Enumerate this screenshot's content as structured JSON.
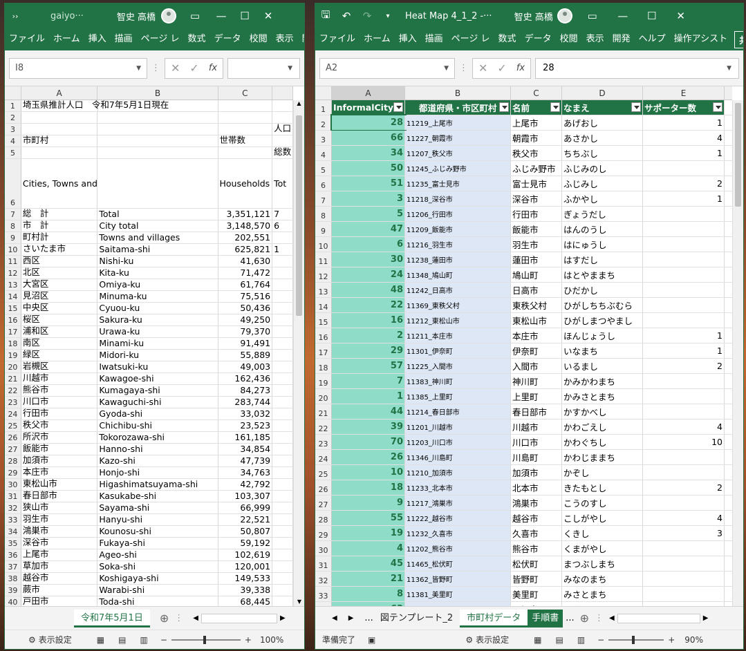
{
  "left": {
    "title": "gaiyo···",
    "user": "智史 高橋",
    "ribbon": [
      "ファイル",
      "ホーム",
      "挿入",
      "描画",
      "ページ レ",
      "数式",
      "データ",
      "校閲",
      "表示",
      "開発"
    ],
    "namebox": "I8",
    "cols": [
      "A",
      "B",
      "C"
    ],
    "rows": [
      {
        "n": "1",
        "a": "埼玉県推計人口　令和7年5月1日現在",
        "b": "",
        "c": "",
        "d": ""
      },
      {
        "n": "2",
        "a": "",
        "b": "",
        "c": "",
        "d": ""
      },
      {
        "n": "3",
        "a": "",
        "b": "",
        "c": "",
        "d": "人口"
      },
      {
        "n": "4",
        "a": "市町村",
        "b": "",
        "c": "世帯数",
        "d": ""
      },
      {
        "n": "5",
        "a": "",
        "b": "",
        "c": "",
        "d": "総数"
      },
      {
        "n": "6",
        "a": "Cities, Towns and Villages",
        "b": "",
        "c": "Households",
        "d": "Tot"
      },
      {
        "n": "7",
        "a": "総　計",
        "b": "Total",
        "c": "3,351,121",
        "d": "7"
      },
      {
        "n": "8",
        "a": "市　計",
        "b": "City total",
        "c": "3,148,570",
        "d": "6"
      },
      {
        "n": "9",
        "a": "町村計",
        "b": "Towns and villages",
        "c": "202,551",
        "d": ""
      },
      {
        "n": "10",
        "a": "さいたま市",
        "b": "Saitama-shi",
        "c": "625,821",
        "d": "1"
      },
      {
        "n": "11",
        "a": "西区",
        "b": "Nishi-ku",
        "c": "41,630",
        "d": ""
      },
      {
        "n": "12",
        "a": "北区",
        "b": "Kita-ku",
        "c": "71,472",
        "d": ""
      },
      {
        "n": "13",
        "a": "大宮区",
        "b": "Omiya-ku",
        "c": "61,764",
        "d": ""
      },
      {
        "n": "14",
        "a": "見沼区",
        "b": "Minuma-ku",
        "c": "75,516",
        "d": ""
      },
      {
        "n": "15",
        "a": "中央区",
        "b": "Cyuou-ku",
        "c": "50,436",
        "d": ""
      },
      {
        "n": "16",
        "a": "桜区",
        "b": "Sakura-ku",
        "c": "49,250",
        "d": ""
      },
      {
        "n": "17",
        "a": "浦和区",
        "b": "Urawa-ku",
        "c": "79,370",
        "d": ""
      },
      {
        "n": "18",
        "a": "南区",
        "b": "Minami-ku",
        "c": "91,491",
        "d": ""
      },
      {
        "n": "19",
        "a": "緑区",
        "b": "Midori-ku",
        "c": "55,889",
        "d": ""
      },
      {
        "n": "20",
        "a": "岩槻区",
        "b": "Iwatsuki-ku",
        "c": "49,003",
        "d": ""
      },
      {
        "n": "21",
        "a": "川越市",
        "b": "Kawagoe-shi",
        "c": "162,436",
        "d": ""
      },
      {
        "n": "22",
        "a": "熊谷市",
        "b": "Kumagaya-shi",
        "c": "84,273",
        "d": ""
      },
      {
        "n": "23",
        "a": "川口市",
        "b": "Kawaguchi-shi",
        "c": "283,744",
        "d": ""
      },
      {
        "n": "24",
        "a": "行田市",
        "b": "Gyoda-shi",
        "c": "33,032",
        "d": ""
      },
      {
        "n": "25",
        "a": "秩父市",
        "b": "Chichibu-shi",
        "c": "23,523",
        "d": ""
      },
      {
        "n": "26",
        "a": "所沢市",
        "b": "Tokorozawa-shi",
        "c": "161,185",
        "d": ""
      },
      {
        "n": "27",
        "a": "飯能市",
        "b": "Hanno-shi",
        "c": "34,854",
        "d": ""
      },
      {
        "n": "28",
        "a": "加須市",
        "b": "Kazo-shi",
        "c": "47,739",
        "d": ""
      },
      {
        "n": "29",
        "a": "本庄市",
        "b": "Honjo-shi",
        "c": "34,763",
        "d": ""
      },
      {
        "n": "30",
        "a": "東松山市",
        "b": "Higashimatsuyama-shi",
        "c": "42,792",
        "d": ""
      },
      {
        "n": "31",
        "a": "春日部市",
        "b": "Kasukabe-shi",
        "c": "103,307",
        "d": ""
      },
      {
        "n": "32",
        "a": "狭山市",
        "b": "Sayama-shi",
        "c": "66,999",
        "d": ""
      },
      {
        "n": "33",
        "a": "羽生市",
        "b": "Hanyu-shi",
        "c": "22,521",
        "d": ""
      },
      {
        "n": "34",
        "a": "鴻巣市",
        "b": "Kounosu-shi",
        "c": "50,807",
        "d": ""
      },
      {
        "n": "35",
        "a": "深谷市",
        "b": "Fukaya-shi",
        "c": "59,192",
        "d": ""
      },
      {
        "n": "36",
        "a": "上尾市",
        "b": "Ageo-shi",
        "c": "102,619",
        "d": ""
      },
      {
        "n": "37",
        "a": "草加市",
        "b": "Soka-shi",
        "c": "120,001",
        "d": ""
      },
      {
        "n": "38",
        "a": "越谷市",
        "b": "Koshigaya-shi",
        "c": "149,533",
        "d": ""
      },
      {
        "n": "39",
        "a": "蕨市",
        "b": "Warabi-shi",
        "c": "39,338",
        "d": ""
      },
      {
        "n": "40",
        "a": "戸田市",
        "b": "Toda-shi",
        "c": "68,445",
        "d": ""
      }
    ],
    "sheet_tab": "令和7年5月1日",
    "status_display": "表示設定",
    "zoom": "100%"
  },
  "right": {
    "title": "Heat Map 4_1_2 -···",
    "user": "智史 高橋",
    "ribbon": [
      "ファイル",
      "ホーム",
      "挿入",
      "描画",
      "ページ レ",
      "数式",
      "データ",
      "校閲",
      "表示",
      "開発",
      "ヘルプ",
      "操作アシスト"
    ],
    "share": "共有",
    "namebox": "A2",
    "formula": "28",
    "cols": [
      "A",
      "B",
      "C",
      "D",
      "E"
    ],
    "headers": [
      "InformalCity",
      "都道府県・市区町村",
      "名前",
      "なまえ",
      "サポーター数"
    ],
    "rows": [
      {
        "n": "2",
        "a": "28",
        "b": "11219_上尾市",
        "c": "上尾市",
        "d": "あげおし",
        "e": "1"
      },
      {
        "n": "3",
        "a": "66",
        "b": "11227_朝霞市",
        "c": "朝霞市",
        "d": "あさかし",
        "e": "4"
      },
      {
        "n": "4",
        "a": "34",
        "b": "11207_秩父市",
        "c": "秩父市",
        "d": "ちちぶし",
        "e": "1"
      },
      {
        "n": "5",
        "a": "50",
        "b": "11245_ふじみ野市",
        "c": "ふじみ野市",
        "d": "ふじみのし",
        "e": ""
      },
      {
        "n": "6",
        "a": "51",
        "b": "11235_富士見市",
        "c": "富士見市",
        "d": "ふじみし",
        "e": "2"
      },
      {
        "n": "7",
        "a": "3",
        "b": "11218_深谷市",
        "c": "深谷市",
        "d": "ふかやし",
        "e": "1"
      },
      {
        "n": "8",
        "a": "5",
        "b": "11206_行田市",
        "c": "行田市",
        "d": "ぎょうだし",
        "e": ""
      },
      {
        "n": "9",
        "a": "47",
        "b": "11209_飯能市",
        "c": "飯能市",
        "d": "はんのうし",
        "e": ""
      },
      {
        "n": "10",
        "a": "6",
        "b": "11216_羽生市",
        "c": "羽生市",
        "d": "はにゅうし",
        "e": ""
      },
      {
        "n": "11",
        "a": "30",
        "b": "11238_蓮田市",
        "c": "蓮田市",
        "d": "はすだし",
        "e": ""
      },
      {
        "n": "12",
        "a": "24",
        "b": "11348_鳩山町",
        "c": "鳩山町",
        "d": "はとやままち",
        "e": ""
      },
      {
        "n": "13",
        "a": "48",
        "b": "11242_日高市",
        "c": "日高市",
        "d": "ひだかし",
        "e": ""
      },
      {
        "n": "14",
        "a": "22",
        "b": "11369_東秩父村",
        "c": "東秩父村",
        "d": "ひがしちちぶむら",
        "e": ""
      },
      {
        "n": "15",
        "a": "16",
        "b": "11212_東松山市",
        "c": "東松山市",
        "d": "ひがしまつやまし",
        "e": ""
      },
      {
        "n": "16",
        "a": "2",
        "b": "11211_本庄市",
        "c": "本庄市",
        "d": "ほんじょうし",
        "e": "1"
      },
      {
        "n": "17",
        "a": "29",
        "b": "11301_伊奈町",
        "c": "伊奈町",
        "d": "いなまち",
        "e": "1"
      },
      {
        "n": "18",
        "a": "57",
        "b": "11225_入間市",
        "c": "入間市",
        "d": "いるまし",
        "e": "2"
      },
      {
        "n": "19",
        "a": "7",
        "b": "11383_神川町",
        "c": "神川町",
        "d": "かみかわまち",
        "e": ""
      },
      {
        "n": "20",
        "a": "1",
        "b": "11385_上里町",
        "c": "上里町",
        "d": "かみさとまち",
        "e": ""
      },
      {
        "n": "21",
        "a": "44",
        "b": "11214_春日部市",
        "c": "春日部市",
        "d": "かすかべし",
        "e": ""
      },
      {
        "n": "22",
        "a": "39",
        "b": "11201_川越市",
        "c": "川越市",
        "d": "かわごえし",
        "e": "4"
      },
      {
        "n": "23",
        "a": "70",
        "b": "11203_川口市",
        "c": "川口市",
        "d": "かわぐちし",
        "e": "10"
      },
      {
        "n": "24",
        "a": "26",
        "b": "11346_川島町",
        "c": "川島町",
        "d": "かわじままち",
        "e": ""
      },
      {
        "n": "25",
        "a": "10",
        "b": "11210_加須市",
        "c": "加須市",
        "d": "かぞし",
        "e": ""
      },
      {
        "n": "26",
        "a": "18",
        "b": "11233_北本市",
        "c": "北本市",
        "d": "きたもとし",
        "e": "2"
      },
      {
        "n": "27",
        "a": "9",
        "b": "11217_鴻巣市",
        "c": "鴻巣市",
        "d": "こうのすし",
        "e": ""
      },
      {
        "n": "28",
        "a": "55",
        "b": "11222_越谷市",
        "c": "越谷市",
        "d": "こしがやし",
        "e": "4"
      },
      {
        "n": "29",
        "a": "19",
        "b": "11232_久喜市",
        "c": "久喜市",
        "d": "くきし",
        "e": "3"
      },
      {
        "n": "30",
        "a": "4",
        "b": "11202_熊谷市",
        "c": "熊谷市",
        "d": "くまがやし",
        "e": ""
      },
      {
        "n": "31",
        "a": "45",
        "b": "11465_松伏町",
        "c": "松伏町",
        "d": "まつぶしまち",
        "e": ""
      },
      {
        "n": "32",
        "a": "21",
        "b": "11362_皆野町",
        "c": "皆野町",
        "d": "みなのまち",
        "e": ""
      },
      {
        "n": "33",
        "a": "8",
        "b": "11381_美里町",
        "c": "美里町",
        "d": "みさとまち",
        "e": ""
      },
      {
        "n": "34",
        "a": "63",
        "b": "11237_三郷市",
        "c": "三郷市",
        "d": "みさとし",
        "e": "2"
      }
    ],
    "sheet_tabs": [
      "図テンプレート_2",
      "市町村データ",
      "手順書"
    ],
    "ellipsis": "...",
    "status_ready": "準備完了",
    "status_display": "表示設定",
    "zoom": "90%"
  }
}
